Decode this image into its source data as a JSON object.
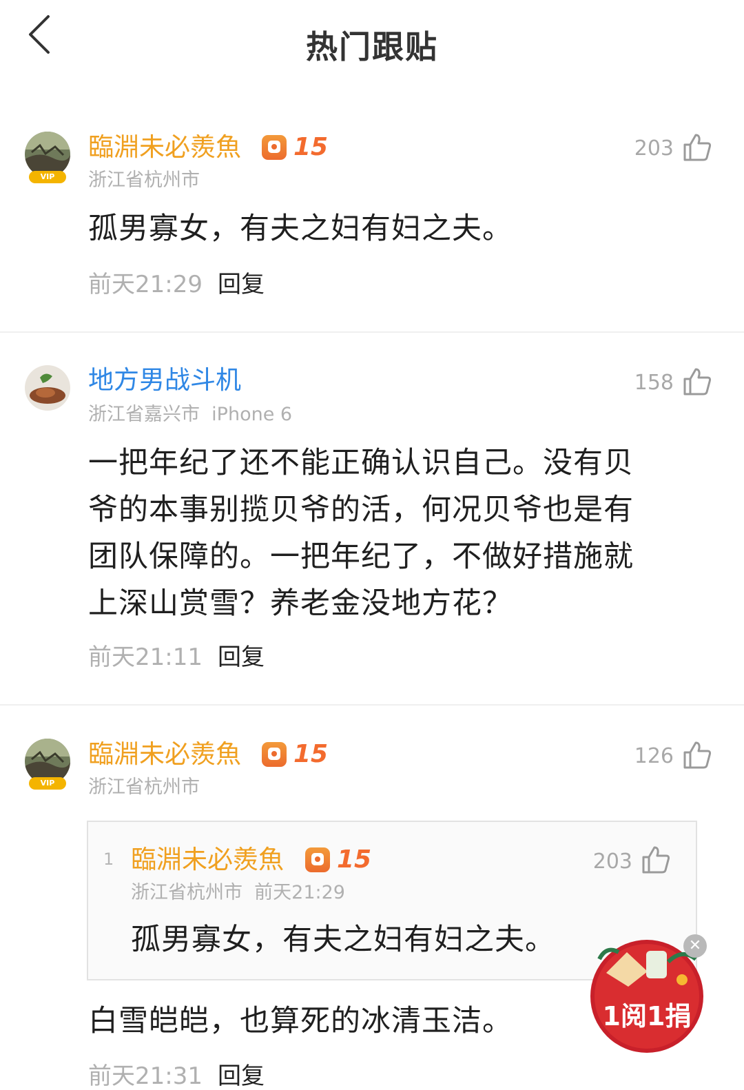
{
  "header": {
    "title": "热门跟贴"
  },
  "comments": [
    {
      "user": "臨淵未必羨魚",
      "level": "15",
      "location": "浙江省杭州市",
      "likes": "203",
      "text": "孤男寡女，有夫之妇有妇之夫。",
      "time": "前天21:29",
      "reply_label": "回复"
    },
    {
      "user": "地方男战斗机",
      "location": "浙江省嘉兴市",
      "device": "iPhone 6",
      "likes": "158",
      "text_lines": [
        "一把年纪了还不能正确认识自己。没有贝",
        "爷的本事别揽贝爷的活，何况贝爷也是有",
        "团队保障的。一把年纪了，不做好措施就",
        "上深山赏雪？养老金没地方花？"
      ],
      "time": "前天21:11",
      "reply_label": "回复"
    },
    {
      "user": "臨淵未必羨魚",
      "level": "15",
      "location": "浙江省杭州市",
      "likes": "126",
      "quote": {
        "index": "1",
        "user": "臨淵未必羨魚",
        "level": "15",
        "location": "浙江省杭州市",
        "time": "前天21:29",
        "likes": "203",
        "text": "孤男寡女，有夫之妇有妇之夫。"
      },
      "text": "白雪皑皑，也算死的冰清玉洁。",
      "time": "前天21:31",
      "reply_label": "回复"
    }
  ],
  "floating_badge": {
    "text": "1阅1捐"
  },
  "colors": {
    "vip_name": "#f0a020",
    "normal_name": "#2f87e5",
    "level": "#f36b2e"
  }
}
